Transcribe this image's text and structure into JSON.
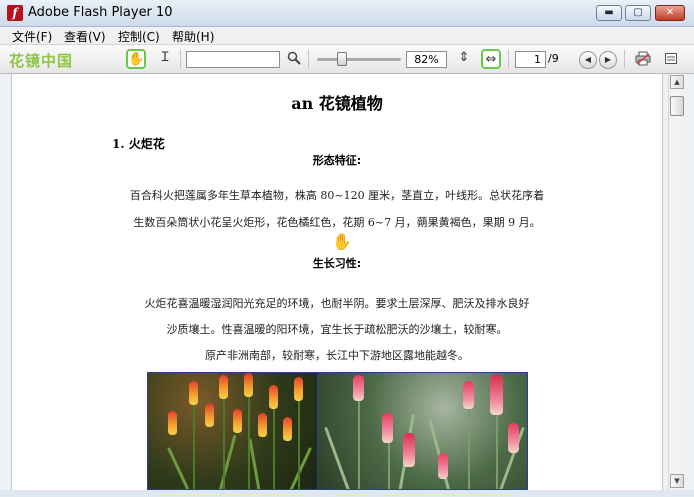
{
  "window": {
    "title": "Adobe Flash Player 10",
    "app_icon": "f",
    "minimize_glyph": "▬",
    "maximize_glyph": "▢",
    "close_glyph": "✕"
  },
  "menu": [
    {
      "label": "文件(F)"
    },
    {
      "label": "查看(V)"
    },
    {
      "label": "控制(C)"
    },
    {
      "label": "帮助(H)"
    }
  ],
  "toolbar": {
    "logo": "花镜中国",
    "hand_icon": "hand-icon",
    "text_select_icon": "text-cursor-icon",
    "search_value": "",
    "zoom_percent": "82%",
    "zoom_slider_level": 0.3,
    "current_page": "1",
    "page_total": "/9",
    "prev_glyph": "◀",
    "next_glyph": "▶"
  },
  "document": {
    "title": "an 花镜植物",
    "section_heading": "1.   火炬花",
    "morph_heading": "形态特征:",
    "morph_lines": [
      "百合科火把莲属多年生草本植物，株高 80~120 厘米，茎直立，叶线形。总状花序着",
      "生数百朵筒状小花呈火炬形，花色橘红色，花期 6~7 月，蒴果黄褐色，果期 9 月。"
    ],
    "habit_heading": "生长习性:",
    "habit_lines": [
      "火炬花喜温暖湿润阳光充足的环境，也耐半阴。要求土层深厚、肥沃及排水良好",
      "沙质壤土。性喜温暖的阳环境，宜生长于疏松肥沃的沙壤土，较耐寒。",
      "原产非洲南部，较耐寒，长江中下游地区露地能越冬。"
    ]
  },
  "colors": {
    "logo_green": "#8fc444",
    "active_tool_border": "#6cc84a",
    "photo_border": "#2a3f8a"
  }
}
